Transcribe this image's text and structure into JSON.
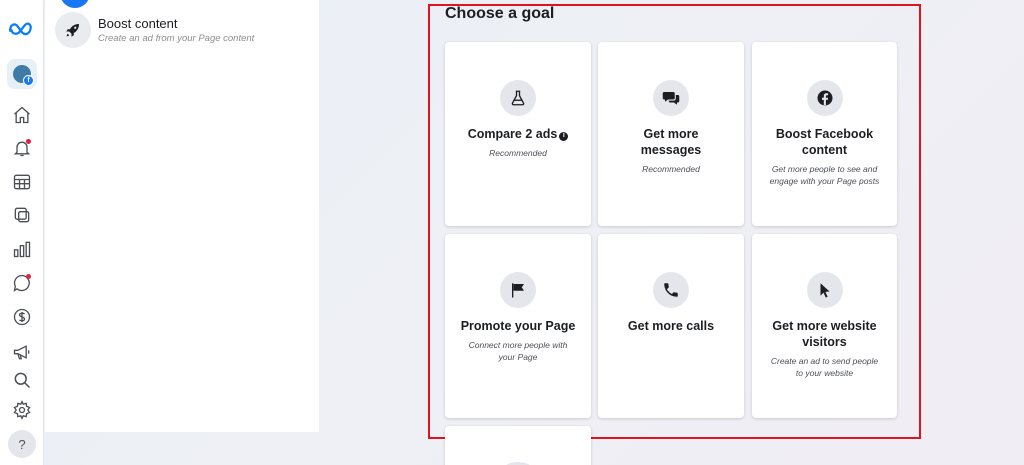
{
  "side_panel": {
    "boost_title": "Boost content",
    "boost_subtitle": "Create an ad from your Page content"
  },
  "main": {
    "title": "Choose a goal",
    "goals": [
      {
        "title": "Compare 2 ads",
        "subtitle": "Recommended",
        "icon": "flask-icon",
        "info": "i"
      },
      {
        "title": "Get more messages",
        "subtitle": "Recommended",
        "icon": "chat-bubbles-icon"
      },
      {
        "title": "Boost Facebook content",
        "subtitle": "Get more people to see and engage with your Page posts",
        "icon": "facebook-icon"
      },
      {
        "title": "Promote your Page",
        "subtitle": "Connect more people with your Page",
        "icon": "flag-icon"
      },
      {
        "title": "Get more calls",
        "subtitle": "",
        "icon": "phone-icon"
      },
      {
        "title": "Get more website visitors",
        "subtitle": "Create an ad to send people to your website",
        "icon": "cursor-icon"
      }
    ]
  },
  "rail": {
    "help_label": "?",
    "badge_label": "f"
  },
  "colors": {
    "accent": "#1877f2",
    "highlight": "#e0141e"
  }
}
